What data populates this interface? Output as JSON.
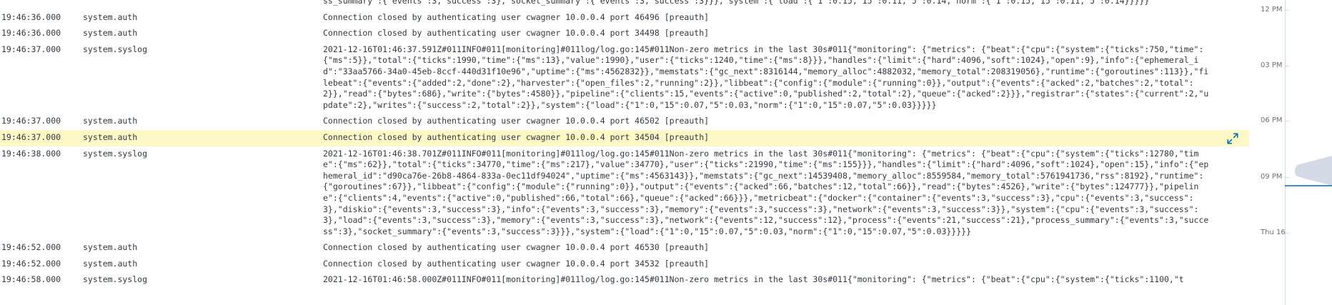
{
  "log_rows": [
    {
      "timestamp": "",
      "dataset": "",
      "message": "ss_summary\":{\"events\":3,\"success\":3},\"socket_summary\":{\"events\":3,\"success\":3}}},\"system\":{\"load\":{\"1\":0.15,\"15\":0.11,\"5\":0.14,\"norm\":{\"1\":0.15,\"15\":0.11,\"5\":0.14}}}}}"
    },
    {
      "timestamp": "19:46:36.000",
      "dataset": "system.auth",
      "message": "Connection closed by authenticating user cwagner 10.0.0.4 port 46496 [preauth]"
    },
    {
      "timestamp": "19:46:36.000",
      "dataset": "system.auth",
      "message": "Connection closed by authenticating user cwagner 10.0.0.4 port 34498 [preauth]"
    },
    {
      "timestamp": "19:46:37.000",
      "dataset": "system.syslog",
      "message": "2021-12-16T01:46:37.591Z#011INFO#011[monitoring]#011log/log.go:145#011Non-zero metrics in the last 30s#011{\"monitoring\": {\"metrics\": {\"beat\":{\"cpu\":{\"system\":{\"ticks\":750,\"time\":{\"ms\":5}},\"total\":{\"ticks\":1990,\"time\":{\"ms\":13},\"value\":1990},\"user\":{\"ticks\":1240,\"time\":{\"ms\":8}}},\"handles\":{\"limit\":{\"hard\":4096,\"soft\":1024},\"open\":9},\"info\":{\"ephemeral_id\":\"33aa5766-34a0-45eb-8ccf-440d31f10e96\",\"uptime\":{\"ms\":4562832}},\"memstats\":{\"gc_next\":8316144,\"memory_alloc\":4882032,\"memory_total\":208319056},\"runtime\":{\"goroutines\":113}},\"filebeat\":{\"events\":{\"added\":2,\"done\":2},\"harvester\":{\"open_files\":2,\"running\":2}},\"libbeat\":{\"config\":{\"module\":{\"running\":0}},\"output\":{\"events\":{\"acked\":2,\"batches\":2,\"total\":2}},\"read\":{\"bytes\":686},\"write\":{\"bytes\":4580}},\"pipeline\":{\"clients\":15,\"events\":{\"active\":0,\"published\":2,\"total\":2},\"queue\":{\"acked\":2}}},\"registrar\":{\"states\":{\"current\":2,\"update\":2},\"writes\":{\"success\":2,\"total\":2}},\"system\":{\"load\":{\"1\":0,\"15\":0.07,\"5\":0.03,\"norm\":{\"1\":0,\"15\":0.07,\"5\":0.03}}}}}"
    },
    {
      "timestamp": "19:46:37.000",
      "dataset": "system.auth",
      "message": "Connection closed by authenticating user cwagner 10.0.0.4 port 46502 [preauth]"
    },
    {
      "timestamp": "19:46:37.000",
      "dataset": "system.auth",
      "message": "Connection closed by authenticating user cwagner 10.0.0.4 port 34504 [preauth]",
      "highlighted": true
    },
    {
      "timestamp": "19:46:38.000",
      "dataset": "system.syslog",
      "message": "2021-12-16T01:46:38.701Z#011INFO#011[monitoring]#011log/log.go:145#011Non-zero metrics in the last 30s#011{\"monitoring\": {\"metrics\": {\"beat\":{\"cpu\":{\"system\":{\"ticks\":12780,\"time\":{\"ms\":62}},\"total\":{\"ticks\":34770,\"time\":{\"ms\":217},\"value\":34770},\"user\":{\"ticks\":21990,\"time\":{\"ms\":155}}},\"handles\":{\"limit\":{\"hard\":4096,\"soft\":1024},\"open\":15},\"info\":{\"ephemeral_id\":\"d90ca76e-26b8-4864-833a-0ec11df94024\",\"uptime\":{\"ms\":4563143}},\"memstats\":{\"gc_next\":14539408,\"memory_alloc\":8559584,\"memory_total\":5761941736,\"rss\":8192},\"runtime\":{\"goroutines\":67}},\"libbeat\":{\"config\":{\"module\":{\"running\":0}},\"output\":{\"events\":{\"acked\":66,\"batches\":12,\"total\":66}},\"read\":{\"bytes\":4526},\"write\":{\"bytes\":124777}},\"pipeline\":{\"clients\":4,\"events\":{\"active\":0,\"published\":66,\"total\":66},\"queue\":{\"acked\":66}}},\"metricbeat\":{\"docker\":{\"container\":{\"events\":3,\"success\":3},\"cpu\":{\"events\":3,\"success\":3},\"diskio\":{\"events\":3,\"success\":3},\"info\":{\"events\":3,\"success\":3},\"memory\":{\"events\":3,\"success\":3},\"network\":{\"events\":3,\"success\":3}},\"system\":{\"cpu\":{\"events\":3,\"success\":3},\"load\":{\"events\":3,\"success\":3},\"memory\":{\"events\":3,\"success\":3},\"network\":{\"events\":12,\"success\":12},\"process\":{\"events\":21,\"success\":21},\"process_summary\":{\"events\":3,\"success\":3},\"socket_summary\":{\"events\":3,\"success\":3}}},\"system\":{\"load\":{\"1\":0,\"15\":0.07,\"5\":0.03,\"norm\":{\"1\":0,\"15\":0.07,\"5\":0.03}}}}}"
    },
    {
      "timestamp": "19:46:52.000",
      "dataset": "system.auth",
      "message": "Connection closed by authenticating user cwagner 10.0.0.4 port 46530 [preauth]"
    },
    {
      "timestamp": "19:46:52.000",
      "dataset": "system.auth",
      "message": "Connection closed by authenticating user cwagner 10.0.0.4 port 34532 [preauth]"
    },
    {
      "timestamp": "19:46:58.000",
      "dataset": "system.syslog",
      "message": "2021-12-16T01:46:58.000Z#011INFO#011[monitoring]#011log/log.go:145#011Non-zero metrics in the last 30s#011{\"monitoring\": {\"metrics\": {\"beat\":{\"cpu\":{\"system\":{\"ticks\":1100,\"t"
    }
  ],
  "timeline": {
    "labels": [
      "12 PM",
      "03 PM",
      "06 PM",
      "09 PM",
      "Thu 16"
    ],
    "colors": {
      "axis": "#d3dae6",
      "distribution": "#d3dae6",
      "marker": "#006bb4"
    }
  },
  "highlight_color": "#fdf8c6",
  "icons": {
    "expand": "expand-icon"
  }
}
